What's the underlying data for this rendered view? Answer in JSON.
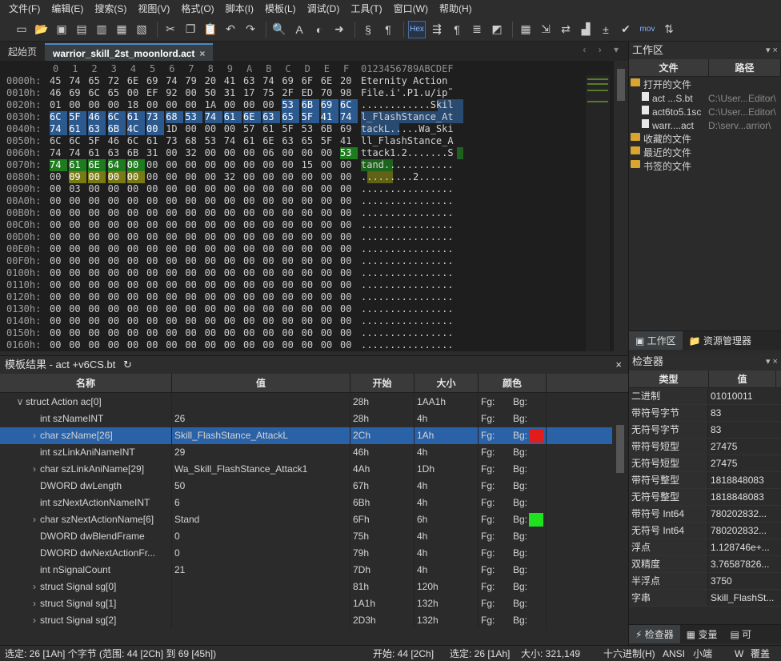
{
  "menu": [
    "文件(F)",
    "编辑(E)",
    "搜索(S)",
    "视图(V)",
    "格式(O)",
    "脚本(I)",
    "模板(L)",
    "调试(D)",
    "工具(T)",
    "窗口(W)",
    "帮助(H)"
  ],
  "toolbar": {
    "hex_label": "Hex",
    "mov_label": "mov"
  },
  "tabs": {
    "start": "起始页",
    "file": "warrior_skill_2st_moonlord.act",
    "close": "×",
    "nav": "‹ › ▾"
  },
  "hex": {
    "col_header": "  0  1  2  3  4  5  6  7  8  9  A  B  C  D  E  F  0123456789ABCDEF",
    "rows": [
      {
        "off": "0000h:",
        "bytes": [
          "45",
          "74",
          "65",
          "72",
          "6E",
          "69",
          "74",
          "79",
          "20",
          "41",
          "63",
          "74",
          "69",
          "6F",
          "6E",
          "20"
        ],
        "ascii": "Eternity Action "
      },
      {
        "off": "0010h:",
        "bytes": [
          "46",
          "69",
          "6C",
          "65",
          "00",
          "EF",
          "92",
          "00",
          "50",
          "31",
          "17",
          "75",
          "2F",
          "ED",
          "70",
          "98"
        ],
        "ascii": "File.i'.P1.u/ip˜"
      },
      {
        "off": "0020h:",
        "bytes": [
          "01",
          "00",
          "00",
          "00",
          "18",
          "00",
          "00",
          "00",
          "1A",
          "00",
          "00",
          "00",
          "53",
          "6B",
          "69",
          "6C"
        ],
        "ascii": "............Skil"
      },
      {
        "off": "0030h:",
        "bytes": [
          "6C",
          "5F",
          "46",
          "6C",
          "61",
          "73",
          "68",
          "53",
          "74",
          "61",
          "6E",
          "63",
          "65",
          "5F",
          "41",
          "74"
        ],
        "ascii": "l_FlashStance_At"
      },
      {
        "off": "0040h:",
        "bytes": [
          "74",
          "61",
          "63",
          "6B",
          "4C",
          "00",
          "1D",
          "00",
          "00",
          "00",
          "57",
          "61",
          "5F",
          "53",
          "6B",
          "69"
        ],
        "ascii": "tackL.....Wa_Ski"
      },
      {
        "off": "0050h:",
        "bytes": [
          "6C",
          "6C",
          "5F",
          "46",
          "6C",
          "61",
          "73",
          "68",
          "53",
          "74",
          "61",
          "6E",
          "63",
          "65",
          "5F",
          "41"
        ],
        "ascii": "ll_FlashStance_A"
      },
      {
        "off": "0060h:",
        "bytes": [
          "74",
          "74",
          "61",
          "63",
          "6B",
          "31",
          "00",
          "32",
          "00",
          "00",
          "00",
          "06",
          "00",
          "00",
          "00",
          "53"
        ],
        "ascii": "ttack1.2.......S"
      },
      {
        "off": "0070h:",
        "bytes": [
          "74",
          "61",
          "6E",
          "64",
          "00",
          "00",
          "00",
          "00",
          "00",
          "00",
          "00",
          "00",
          "00",
          "15",
          "00",
          "00"
        ],
        "ascii": "tand............"
      },
      {
        "off": "0080h:",
        "bytes": [
          "00",
          "09",
          "00",
          "00",
          "00",
          "00",
          "00",
          "00",
          "00",
          "32",
          "00",
          "00",
          "00",
          "00",
          "00",
          "00"
        ],
        "ascii": ".........2......"
      },
      {
        "off": "0090h:",
        "bytes": [
          "00",
          "03",
          "00",
          "00",
          "00",
          "00",
          "00",
          "00",
          "00",
          "00",
          "00",
          "00",
          "00",
          "00",
          "00",
          "00"
        ],
        "ascii": "................"
      },
      {
        "off": "00A0h:",
        "bytes": [
          "00",
          "00",
          "00",
          "00",
          "00",
          "00",
          "00",
          "00",
          "00",
          "00",
          "00",
          "00",
          "00",
          "00",
          "00",
          "00"
        ],
        "ascii": "................"
      },
      {
        "off": "00B0h:",
        "bytes": [
          "00",
          "00",
          "00",
          "00",
          "00",
          "00",
          "00",
          "00",
          "00",
          "00",
          "00",
          "00",
          "00",
          "00",
          "00",
          "00"
        ],
        "ascii": "................"
      },
      {
        "off": "00C0h:",
        "bytes": [
          "00",
          "00",
          "00",
          "00",
          "00",
          "00",
          "00",
          "00",
          "00",
          "00",
          "00",
          "00",
          "00",
          "00",
          "00",
          "00"
        ],
        "ascii": "................"
      },
      {
        "off": "00D0h:",
        "bytes": [
          "00",
          "00",
          "00",
          "00",
          "00",
          "00",
          "00",
          "00",
          "00",
          "00",
          "00",
          "00",
          "00",
          "00",
          "00",
          "00"
        ],
        "ascii": "................"
      },
      {
        "off": "00E0h:",
        "bytes": [
          "00",
          "00",
          "00",
          "00",
          "00",
          "00",
          "00",
          "00",
          "00",
          "00",
          "00",
          "00",
          "00",
          "00",
          "00",
          "00"
        ],
        "ascii": "................"
      },
      {
        "off": "00F0h:",
        "bytes": [
          "00",
          "00",
          "00",
          "00",
          "00",
          "00",
          "00",
          "00",
          "00",
          "00",
          "00",
          "00",
          "00",
          "00",
          "00",
          "00"
        ],
        "ascii": "................"
      },
      {
        "off": "0100h:",
        "bytes": [
          "00",
          "00",
          "00",
          "00",
          "00",
          "00",
          "00",
          "00",
          "00",
          "00",
          "00",
          "00",
          "00",
          "00",
          "00",
          "00"
        ],
        "ascii": "................"
      },
      {
        "off": "0110h:",
        "bytes": [
          "00",
          "00",
          "00",
          "00",
          "00",
          "00",
          "00",
          "00",
          "00",
          "00",
          "00",
          "00",
          "00",
          "00",
          "00",
          "00"
        ],
        "ascii": "................"
      },
      {
        "off": "0120h:",
        "bytes": [
          "00",
          "00",
          "00",
          "00",
          "00",
          "00",
          "00",
          "00",
          "00",
          "00",
          "00",
          "00",
          "00",
          "00",
          "00",
          "00"
        ],
        "ascii": "................"
      },
      {
        "off": "0130h:",
        "bytes": [
          "00",
          "00",
          "00",
          "00",
          "00",
          "00",
          "00",
          "00",
          "00",
          "00",
          "00",
          "00",
          "00",
          "00",
          "00",
          "00"
        ],
        "ascii": "................"
      },
      {
        "off": "0140h:",
        "bytes": [
          "00",
          "00",
          "00",
          "00",
          "00",
          "00",
          "00",
          "00",
          "00",
          "00",
          "00",
          "00",
          "00",
          "00",
          "00",
          "00"
        ],
        "ascii": "................"
      },
      {
        "off": "0150h:",
        "bytes": [
          "00",
          "00",
          "00",
          "00",
          "00",
          "00",
          "00",
          "00",
          "00",
          "00",
          "00",
          "00",
          "00",
          "00",
          "00",
          "00"
        ],
        "ascii": "................"
      },
      {
        "off": "0160h:",
        "bytes": [
          "00",
          "00",
          "00",
          "00",
          "00",
          "00",
          "00",
          "00",
          "00",
          "00",
          "00",
          "00",
          "00",
          "00",
          "00",
          "00"
        ],
        "ascii": "................"
      }
    ],
    "colors": {
      "blue": "#2d5a8e",
      "green": "#1e7b1e",
      "olive": "#7a7a14"
    }
  },
  "workspace": {
    "title": "工作区",
    "col_file": "文件",
    "col_path": "路径",
    "open_files": "打开的文件",
    "files": [
      {
        "name": "act ...S.bt",
        "path": "C:\\User...Editor\\"
      },
      {
        "name": "act6to5.1sc",
        "path": "C:\\User...Editor\\"
      },
      {
        "name": "warr....act",
        "path": "D:\\serv...arrior\\"
      }
    ],
    "favorites": "收藏的文件",
    "recent": "最近的文件",
    "bookmarks": "书签的文件",
    "tab_workspace": "工作区",
    "tab_explorer": "资源管理器"
  },
  "inspector": {
    "title": "检查器",
    "col_type": "类型",
    "col_value": "值",
    "rows": [
      {
        "k": "二进制",
        "v": "01010011"
      },
      {
        "k": "带符号字节",
        "v": "83"
      },
      {
        "k": "无符号字节",
        "v": "83"
      },
      {
        "k": "带符号短型",
        "v": "27475"
      },
      {
        "k": "无符号短型",
        "v": "27475"
      },
      {
        "k": "带符号整型",
        "v": "1818848083"
      },
      {
        "k": "无符号整型",
        "v": "1818848083"
      },
      {
        "k": "带符号 Int64",
        "v": "780202832..."
      },
      {
        "k": "无符号 Int64",
        "v": "780202832..."
      },
      {
        "k": "浮点",
        "v": "1.128746e+..."
      },
      {
        "k": "双精度",
        "v": "3.76587826..."
      },
      {
        "k": "半浮点",
        "v": "3750"
      },
      {
        "k": "字串",
        "v": "Skill_FlashSt..."
      }
    ],
    "tab_inspector": "检查器",
    "tab_vars": "变量",
    "tab_more": "可"
  },
  "template": {
    "title": "模板结果 - act +v6CS.bt",
    "refresh": "↻",
    "close": "×",
    "headers": {
      "name": "名称",
      "value": "值",
      "start": "开始",
      "size": "大小",
      "color": "颜色"
    },
    "rows": [
      {
        "name": "struct Action ac[0]",
        "value": "",
        "start": "28h",
        "size": "1AA1h",
        "fg": "Fg:",
        "bg": "Bg:",
        "indent": 0,
        "caret": "∨",
        "swatch": ""
      },
      {
        "name": "int szNameINT",
        "value": "26",
        "start": "28h",
        "size": "4h",
        "fg": "Fg:",
        "bg": "Bg:",
        "indent": 1,
        "caret": "",
        "swatch": ""
      },
      {
        "name": "char szName[26]",
        "value": "Skill_FlashStance_AttackL",
        "start": "2Ch",
        "size": "1Ah",
        "fg": "Fg:",
        "bg": "Bg:",
        "indent": 1,
        "caret": "›",
        "swatch": "#e21b1b"
      },
      {
        "name": "int szLinkAniNameINT",
        "value": "29",
        "start": "46h",
        "size": "4h",
        "fg": "Fg:",
        "bg": "Bg:",
        "indent": 1,
        "caret": "",
        "swatch": ""
      },
      {
        "name": "char szLinkAniName[29]",
        "value": "Wa_Skill_FlashStance_Attack1",
        "start": "4Ah",
        "size": "1Dh",
        "fg": "Fg:",
        "bg": "Bg:",
        "indent": 1,
        "caret": "›",
        "swatch": ""
      },
      {
        "name": "DWORD dwLength",
        "value": "50",
        "start": "67h",
        "size": "4h",
        "fg": "Fg:",
        "bg": "Bg:",
        "indent": 1,
        "caret": "",
        "swatch": ""
      },
      {
        "name": "int szNextActionNameINT",
        "value": "6",
        "start": "6Bh",
        "size": "4h",
        "fg": "Fg:",
        "bg": "Bg:",
        "indent": 1,
        "caret": "",
        "swatch": ""
      },
      {
        "name": "char szNextActionName[6]",
        "value": "Stand",
        "start": "6Fh",
        "size": "6h",
        "fg": "Fg:",
        "bg": "Bg:",
        "indent": 1,
        "caret": "›",
        "swatch": "#1ee21e"
      },
      {
        "name": "DWORD dwBlendFrame",
        "value": "0",
        "start": "75h",
        "size": "4h",
        "fg": "Fg:",
        "bg": "Bg:",
        "indent": 1,
        "caret": "",
        "swatch": ""
      },
      {
        "name": "DWORD dwNextActionFr...",
        "value": "0",
        "start": "79h",
        "size": "4h",
        "fg": "Fg:",
        "bg": "Bg:",
        "indent": 1,
        "caret": "",
        "swatch": ""
      },
      {
        "name": "int nSignalCount",
        "value": "21",
        "start": "7Dh",
        "size": "4h",
        "fg": "Fg:",
        "bg": "Bg:",
        "indent": 1,
        "caret": "",
        "swatch": ""
      },
      {
        "name": "struct Signal sg[0]",
        "value": "",
        "start": "81h",
        "size": "120h",
        "fg": "Fg:",
        "bg": "Bg:",
        "indent": 1,
        "caret": "›",
        "swatch": ""
      },
      {
        "name": "struct Signal sg[1]",
        "value": "",
        "start": "1A1h",
        "size": "132h",
        "fg": "Fg:",
        "bg": "Bg:",
        "indent": 1,
        "caret": "›",
        "swatch": ""
      },
      {
        "name": "struct Signal sg[2]",
        "value": "",
        "start": "2D3h",
        "size": "132h",
        "fg": "Fg:",
        "bg": "Bg:",
        "indent": 1,
        "caret": "›",
        "swatch": ""
      }
    ]
  },
  "status": {
    "selection": "选定: 26 [1Ah] 个字节 (范围: 44 [2Ch] 到 69 [45h])",
    "start": "开始: 44 [2Ch]",
    "sel": "选定: 26 [1Ah]",
    "size": "大小: 321,149",
    "hexmode": "十六进制(H)",
    "encoding": "ANSI",
    "endian": "小端",
    "w": "W",
    "overwrite": "覆盖"
  }
}
